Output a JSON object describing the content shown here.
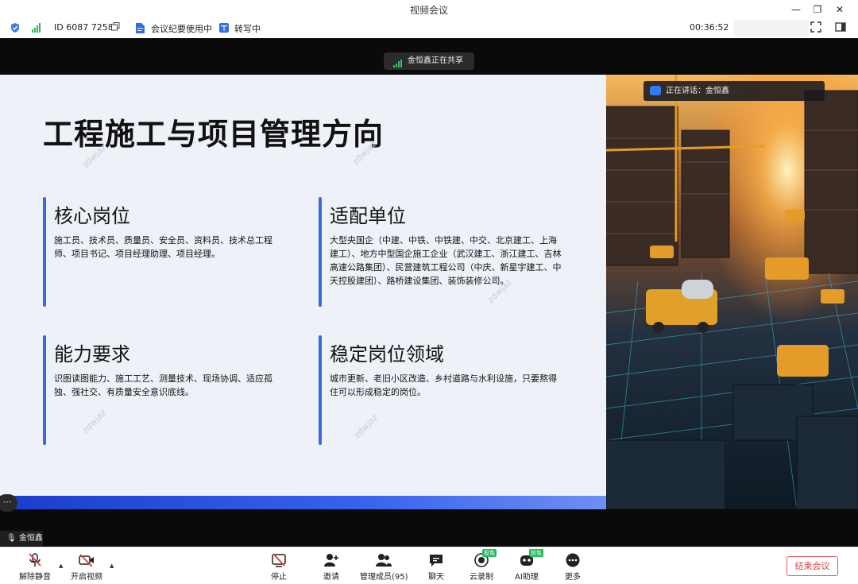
{
  "window": {
    "title": "视频会议"
  },
  "infobar": {
    "meeting_id": "ID 6087 7258",
    "minutes_status": "会议纪要使用中",
    "transcribe_status": "转写中",
    "elapsed": "00:36:52"
  },
  "share_banner": "金恒鑫正在共享",
  "slide": {
    "title": "工程施工与项目管理方向",
    "watermark": "zdwjaz",
    "blocks": [
      {
        "heading": "核心岗位",
        "body": "施工员、技术员、质量员、安全员、资料员、技术总工程师、项目书记、项目经理助理、项目经理。"
      },
      {
        "heading": "适配单位",
        "body": "大型央国企（中建、中铁、中铁建、中交、北京建工、上海建工）、地方中型国企施工企业（武汉建工、浙江建工、吉林高速公路集团）、民营建筑工程公司（中庆、新星宇建工、中天控股建团）、路桥建设集团、装饰装修公司。"
      },
      {
        "heading": "能力要求",
        "body": "识图读图能力、施工工艺、测量技术、现场协调、适应孤独、强社交、有质量安全意识底线。"
      },
      {
        "heading": "稳定岗位领域",
        "body": "城市更新、老旧小区改造、乡村道路与水利设施，只要熬得住可以形成稳定的岗位。"
      }
    ]
  },
  "speaking": "正在讲话：金恒鑫",
  "self_name": "金恒鑫",
  "toolbar": {
    "unmute": "解除静音",
    "start_video": "开启视频",
    "stop": "停止",
    "invite": "邀请",
    "manage_members": "管理成员(95)",
    "chat": "聊天",
    "cloud_record": "云录制",
    "ai_assistant": "AI助理",
    "more": "更多",
    "badge_cloud": "投免",
    "badge_ai": "投免",
    "end_meeting": "结束会议"
  },
  "colors": {
    "accent_blue": "#3a6ae0",
    "end_red": "#e04444",
    "record_green": "#22b85a"
  }
}
